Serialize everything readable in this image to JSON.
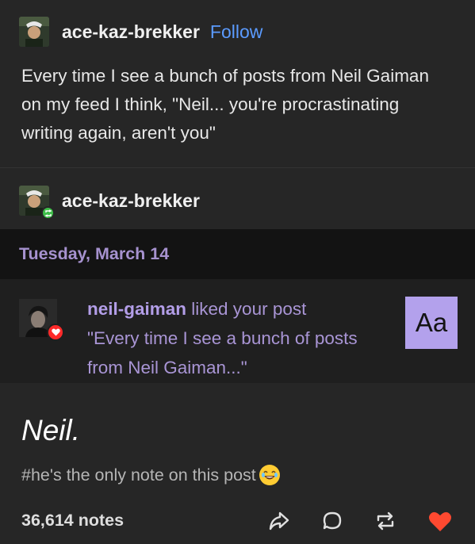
{
  "post": {
    "username": "ace-kaz-brekker",
    "follow_label": "Follow",
    "body": "Every time I see a bunch of posts from Neil Gaiman on my feed I think, \"Neil... you're procrastinating writing again, aren't you\""
  },
  "reblog": {
    "username": "ace-kaz-brekker",
    "date": "Tuesday, March 14",
    "activity": {
      "user": "neil-gaiman",
      "action": " liked your post",
      "quote": "\"Every time I see a bunch of posts from Neil Gaiman...\"",
      "aa_label": "Aa"
    },
    "heading": "Neil.",
    "tags": "#he's the only note on this post"
  },
  "footer": {
    "notes": "36,614 notes"
  },
  "icons": [
    "share-icon",
    "reply-icon",
    "reblog-icon",
    "like-icon"
  ],
  "colors": {
    "follow": "#5b9bff",
    "date": "#a692cf",
    "like": "#ff4930",
    "aa_box": "#b3a1ec"
  }
}
